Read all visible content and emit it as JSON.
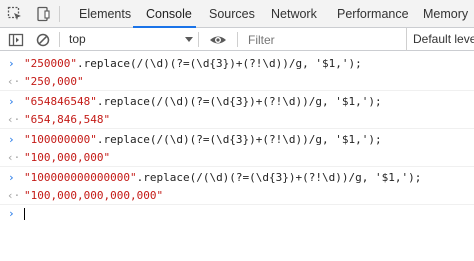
{
  "tabs": {
    "items": [
      "Elements",
      "Console",
      "Sources",
      "Network",
      "Performance",
      "Memory"
    ],
    "active": "Console"
  },
  "toolbar": {
    "context": "top",
    "filter_placeholder": "Filter",
    "levels": "Default levels"
  },
  "console": {
    "entries": [
      {
        "input_str": "\"250000\"",
        "input_rest": ".replace(/(\\d)(?=(\\d{3})+(?!\\d))/g, '$1,');",
        "output": "\"250,000\""
      },
      {
        "input_str": "\"654846548\"",
        "input_rest": ".replace(/(\\d)(?=(\\d{3})+(?!\\d))/g, '$1,');",
        "output": "\"654,846,548\""
      },
      {
        "input_str": "\"100000000\"",
        "input_rest": ".replace(/(\\d)(?=(\\d{3})+(?!\\d))/g, '$1,');",
        "output": "\"100,000,000\""
      },
      {
        "input_str": "\"100000000000000\"",
        "input_rest": ".replace(/(\\d)(?=(\\d{3})+(?!\\d))/g, '$1,');",
        "output": "\"100,000,000,000,000\""
      }
    ],
    "prompt_symbol": "›",
    "return_symbol": "‹·"
  },
  "colors": {
    "accent": "#1a73e8",
    "string": "#c41a16",
    "tabbar_bg": "#f3f3f3"
  }
}
